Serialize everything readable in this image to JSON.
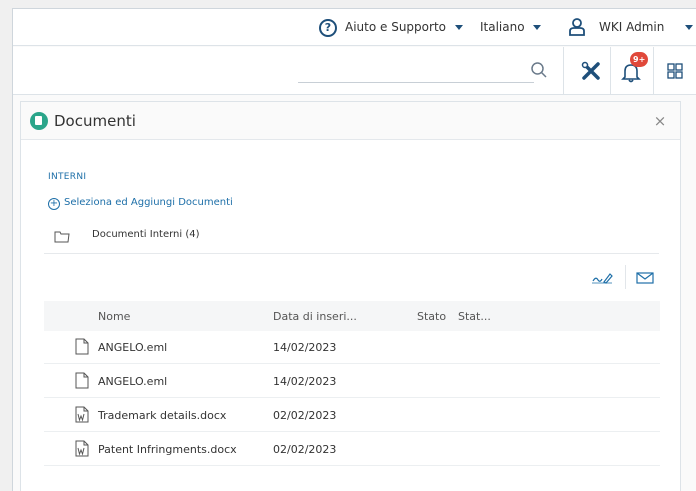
{
  "topbar": {
    "help_label": "Aiuto e Supporto",
    "language_label": "Italiano",
    "user_label": "WKI Admin"
  },
  "toolbar": {
    "search_placeholder": "",
    "notifications_badge": "9+"
  },
  "panel": {
    "title": "Documenti",
    "section_label": "INTERNI",
    "add_documents_label": "Seleziona ed Aggiungi Documenti",
    "folder_label": "Documenti Interni (4)"
  },
  "table": {
    "columns": [
      "Nome",
      "Data di inseri...",
      "Stato",
      "Stat..."
    ],
    "rows": [
      {
        "name": "ANGELO.eml",
        "date": "14/02/2023",
        "icon": "generic-file-icon"
      },
      {
        "name": "ANGELO.eml",
        "date": "14/02/2023",
        "icon": "generic-file-icon"
      },
      {
        "name": "Trademark details.docx",
        "date": "02/02/2023",
        "icon": "word-file-icon"
      },
      {
        "name": "Patent Infringments.docx",
        "date": "02/02/2023",
        "icon": "word-file-icon"
      }
    ]
  },
  "colors": {
    "accent": "#1e6fa8",
    "brand_dark": "#1e4f7a",
    "badge": "#e0483a",
    "doc_logo": "#2aa58a"
  }
}
